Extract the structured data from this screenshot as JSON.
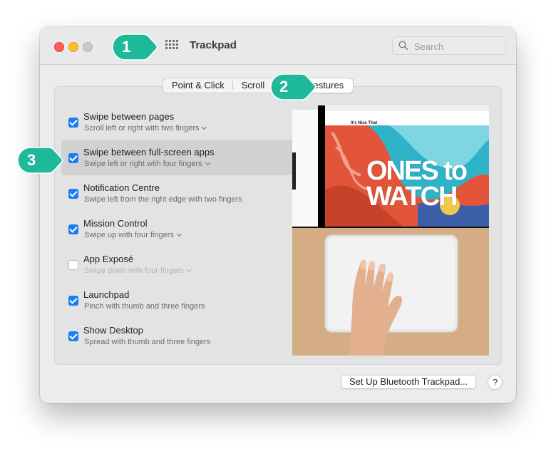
{
  "window": {
    "title": "Trackpad",
    "search_placeholder": "Search"
  },
  "tabs": [
    {
      "label": "Point & Click",
      "active": false
    },
    {
      "label": "Scroll",
      "active": false
    },
    {
      "label": "More Gestures",
      "active": true
    }
  ],
  "gestures": [
    {
      "label": "Swipe between pages",
      "sub": "Scroll left or right with two fingers",
      "checked": true,
      "dropdown": true
    },
    {
      "label": "Swipe between full-screen apps",
      "sub": "Swipe left or right with four fingers",
      "checked": true,
      "dropdown": true,
      "selected": true
    },
    {
      "label": "Notification Centre",
      "sub": "Swipe left from the right edge with two fingers",
      "checked": true,
      "dropdown": false
    },
    {
      "label": "Mission Control",
      "sub": "Swipe up with four fingers",
      "checked": true,
      "dropdown": true
    },
    {
      "label": "App Exposé",
      "sub": "Swipe down with four fingers",
      "checked": false,
      "dropdown": true
    },
    {
      "label": "Launchpad",
      "sub": "Pinch with thumb and three fingers",
      "checked": true,
      "dropdown": false
    },
    {
      "label": "Show Desktop",
      "sub": "Spread with thumb and three fingers",
      "checked": true,
      "dropdown": false
    }
  ],
  "preview": {
    "hero_text": "ONES to WATCH",
    "site_brand": "It's Nice That"
  },
  "footer": {
    "bluetooth_button": "Set Up Bluetooth Trackpad...",
    "help_button": "?"
  },
  "callouts": [
    "1",
    "2",
    "3"
  ],
  "colors": {
    "accent": "#1a7ef2",
    "callout": "#1db99a",
    "close": "#ff5f57",
    "minimize": "#febc2e"
  }
}
